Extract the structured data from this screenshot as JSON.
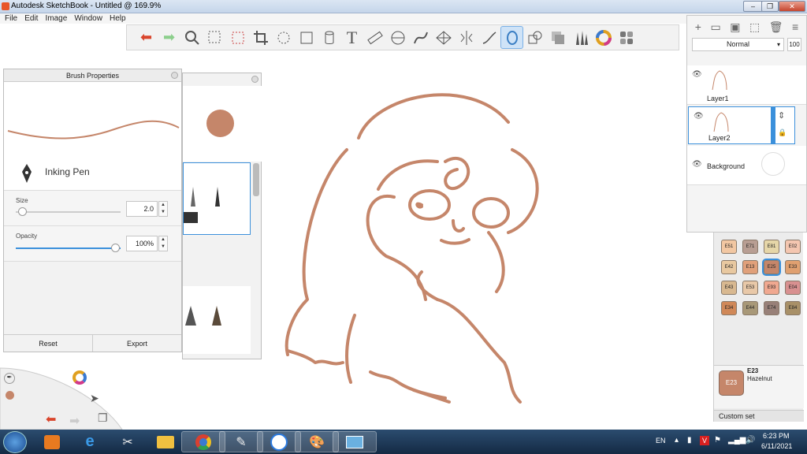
{
  "window": {
    "title": "Autodesk SketchBook - Untitled @ 169.9%",
    "min": "–",
    "max": "❐",
    "close": "✕"
  },
  "menu": [
    "File",
    "Edit",
    "Image",
    "Window",
    "Help"
  ],
  "layers_panel": {
    "blend_mode": "Normal",
    "opacity": "100",
    "layers": [
      {
        "name": "Layer1"
      },
      {
        "name": "Layer2"
      },
      {
        "name": "Background"
      }
    ]
  },
  "brush_properties": {
    "title": "Brush Properties",
    "brush_name": "Inking Pen",
    "size_label": "Size",
    "size_value": "2.0",
    "opacity_label": "Opacity",
    "opacity_value": "100%",
    "reset_label": "Reset",
    "export_label": "Export"
  },
  "copic": {
    "row0": [
      "E51",
      "E71",
      "E81",
      "E02"
    ],
    "row1": [
      "E42",
      "E13",
      "E25",
      "E33"
    ],
    "row2": [
      "E43",
      "E53",
      "E93",
      "E04"
    ],
    "row3": [
      "E34",
      "E44",
      "E74",
      "E84"
    ],
    "selected_code": "E23",
    "selected_name": "Hazelnut",
    "selected_chip": "E23",
    "set_label": "Custom set"
  },
  "taskbar": {
    "lang": "EN",
    "time": "6:23 PM",
    "date": "6/11/2021"
  },
  "colors": {
    "brush_color": "#c5866a",
    "accent": "#3b90db"
  }
}
